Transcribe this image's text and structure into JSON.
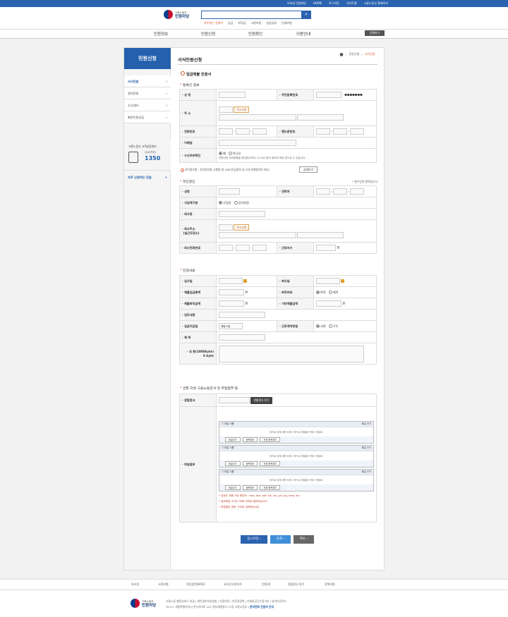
{
  "top_links": [
    "모바일 민원마당",
    "HOME",
    "로그아웃",
    "사이트맵",
    "고용노동부 홈페이지"
  ],
  "logo": {
    "ministry": "고용노동부",
    "name": "민원마당"
  },
  "search": {
    "placeholder": ""
  },
  "keywords": [
    "자주찾는 검색어",
    "임금",
    "퇴직금",
    "고용보험",
    "실업급여",
    "산재보험"
  ],
  "gnb": [
    "민원정보",
    "민원신청",
    "민원확인",
    "이용안내"
  ],
  "all_menu": "전체보기",
  "lnb": {
    "title": "민원신청",
    "items": [
      "서식민원",
      "질의민원",
      "신고센터",
      "빠른민원상담"
    ],
    "call_title": "고용노동부 고객상담센터",
    "call_sub": "(유료전화)",
    "call_num": "1350",
    "freq": "자주 신청하는 민원"
  },
  "page_title": "서식민원신청",
  "breadcrumb": [
    "민원신청",
    "서식민원"
  ],
  "form_title": "임금체불 진정서",
  "sections": {
    "applicant": "등록인 정보",
    "respondent": "피진정인",
    "content": "진정내용",
    "office": "관할 지방 고용노동관서 및 파일첨부 등",
    "required": "* 필수입력 항목입니다"
  },
  "applicant": {
    "name": "성 명",
    "rrn": "주민등록번호",
    "rrn_mask": "●●●●●●●",
    "address": "주 소",
    "addr_btn": "주소조회",
    "phone": "전화번호",
    "mobile": "핸드폰번호",
    "email": "이메일",
    "sms": "수신여부확인",
    "yes": "예",
    "no": "아니오",
    "sms_note": "민원신청 처리현황을 휴대폰(SMS), E-mail 등의 정보로 제공 받으실 수 있습니다.",
    "notice": "전자정부법 : 전자정부법 시행령 제 18조(민감정보 및 고유식별정보의 처리)",
    "detail_btn": "상세보기"
  },
  "respondent": {
    "name": "성명",
    "contact": "연락처",
    "biz_type": "사업체구분",
    "biz": "사업장",
    "private": "공사현장",
    "company": "회사명",
    "company_addr": "회사주소",
    "company_addr_sub": "(실근무장소)",
    "addr_btn": "주소조회",
    "company_phone": "회사전화번호",
    "workers": "근로자수",
    "workers_unit": "명"
  },
  "content": {
    "join": "입사일",
    "leave": "퇴사일",
    "unpaid_total": "체불임금총액",
    "won": "원",
    "retire": "퇴직여부",
    "retired": "퇴직",
    "working": "재직",
    "unpaid_retire": "체불퇴직금액",
    "other_unpaid": "기타체불금액",
    "duty": "업무내용",
    "payday": "임금지급일",
    "payday_value": "매월 0일",
    "contract": "근로계약방법",
    "written": "서면",
    "oral": "구두",
    "subject": "제 목",
    "body": "내 용(1000byte)",
    "bytes": "0 byte"
  },
  "office": {
    "label": "관할관서",
    "find_btn": "관할관서 찾기",
    "attach": "파일첨부",
    "file_name": "파일 이름",
    "file_size": "파일 크기",
    "drop": "여기로 마우스를 드래그 하거나 파일을 드래그 하세요.",
    "add": "파일추가",
    "remove_sel": "항목제거",
    "remove_all": "전체 항목제거",
    "notes": [
      "업로드 허용 가능 확장자 : hwp, doc, pdf, txt, xls, gif, jpg, bmp, zip",
      "첨부파일 크기는 5MB 이하로 첨부하십시오.",
      "파일명은 영문, 숫자로 입력하십시오."
    ]
  },
  "buttons": {
    "temp": "임시저장",
    "submit": "등록",
    "cancel": "취소"
  },
  "footer_links": [
    "워크넷",
    "고용보험",
    "직업훈련(HRD)",
    "외국인고용허가",
    "민원24",
    "관할관서 찾기",
    "정책자원"
  ],
  "footer": {
    "policy": "고용노동 행정서비스 헌장 | 개인정보처리방침 | 이용약관 | 저작권정책 | 이메일무단수집거부 | 뷰어다운로드",
    "address": "30117 세종특별자치시 한누리대로 422 정부세종청사 11동 고용노동부",
    "contact": "문의전화 민원처 안내"
  }
}
